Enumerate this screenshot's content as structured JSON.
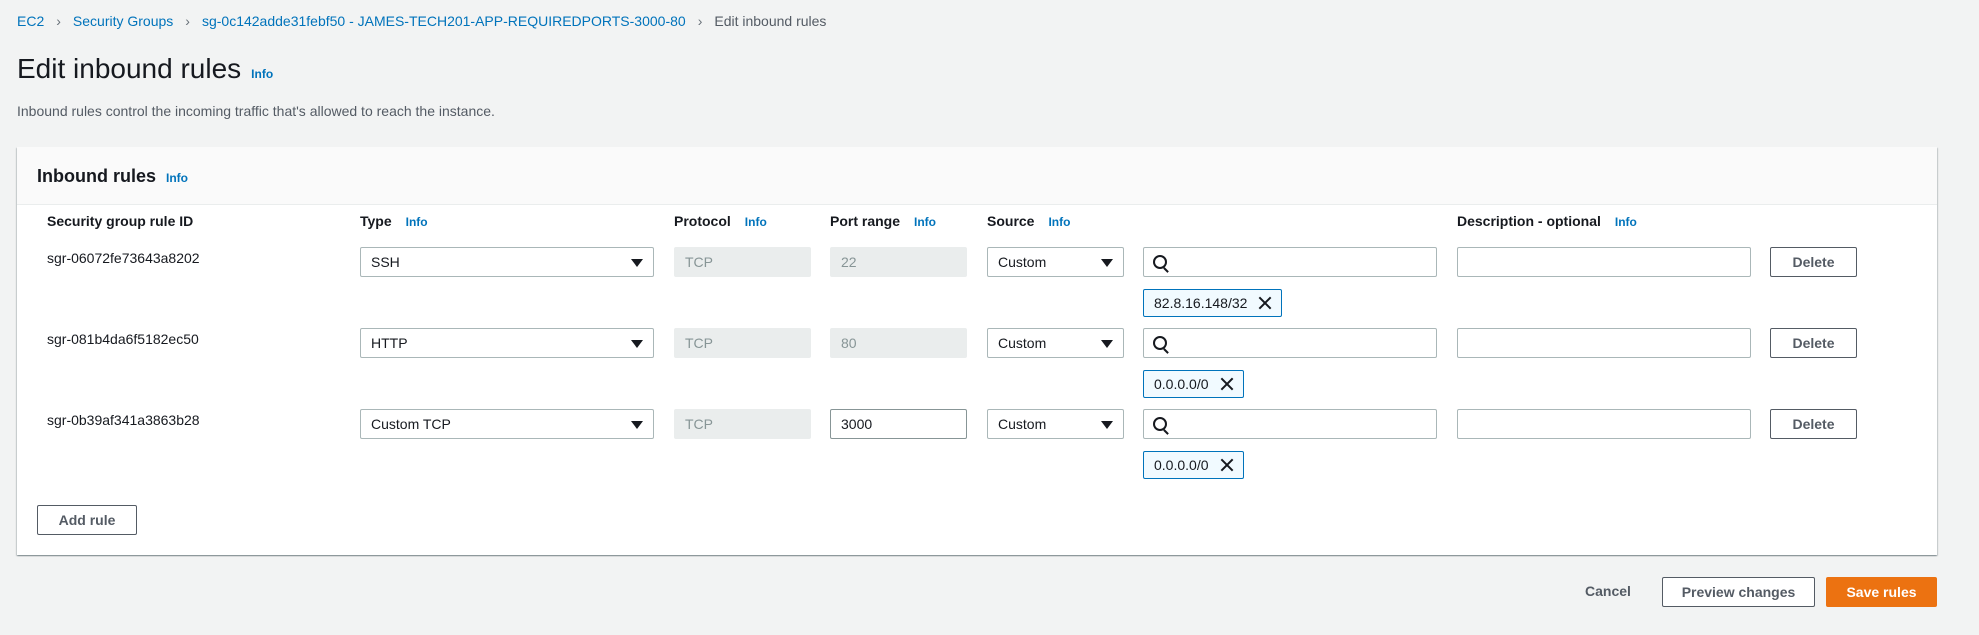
{
  "breadcrumb": {
    "items": [
      "EC2",
      "Security Groups",
      "sg-0c142adde31febf50 - JAMES-TECH201-APP-REQUIREDPORTS-3000-80"
    ],
    "current": "Edit inbound rules"
  },
  "page": {
    "title": "Edit inbound rules",
    "info": "Info",
    "description": "Inbound rules control the incoming traffic that's allowed to reach the instance."
  },
  "panel": {
    "title": "Inbound rules",
    "info": "Info",
    "columns": {
      "rule_id": "Security group rule ID",
      "type": "Type",
      "protocol": "Protocol",
      "port_range": "Port range",
      "source": "Source",
      "description": "Description - optional",
      "info": "Info"
    },
    "search_icon": "search-icon",
    "rules": [
      {
        "id": "sgr-06072fe73643a8202",
        "type": "SSH",
        "protocol": "TCP",
        "port": "22",
        "port_editable": false,
        "source": "Custom",
        "cidr": "82.8.16.148/32",
        "description": "",
        "delete": "Delete"
      },
      {
        "id": "sgr-081b4da6f5182ec50",
        "type": "HTTP",
        "protocol": "TCP",
        "port": "80",
        "port_editable": false,
        "source": "Custom",
        "cidr": "0.0.0.0/0",
        "description": "",
        "delete": "Delete"
      },
      {
        "id": "sgr-0b39af341a3863b28",
        "type": "Custom TCP",
        "protocol": "TCP",
        "port": "3000",
        "port_editable": true,
        "source": "Custom",
        "cidr": "0.0.0.0/0",
        "description": "",
        "delete": "Delete"
      }
    ],
    "add_rule": "Add rule"
  },
  "footer": {
    "cancel": "Cancel",
    "preview": "Preview changes",
    "save": "Save rules"
  },
  "colors": {
    "primary": "#ec7211",
    "link": "#0073bb",
    "background": "#f2f3f3"
  }
}
